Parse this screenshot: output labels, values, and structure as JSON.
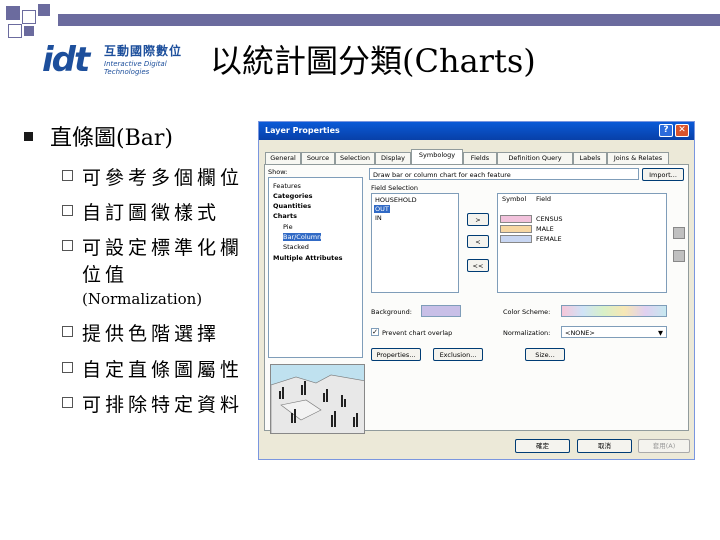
{
  "slide": {
    "title": "以統計圖分類(Charts)",
    "logo_mark": "idt",
    "logo_cn": "互動國際數位",
    "logo_en": "Interactive Digital Technologies",
    "heading": "直條圖(Bar)",
    "bullets": [
      "可參考多個欄位",
      "自訂圖徵樣式",
      "可設定標準化欄",
      "位值"
    ],
    "normalization_note": "(Normalization)",
    "bullets2": [
      "提供色階選擇",
      "自定直條圖屬性",
      "可排除特定資料"
    ]
  },
  "dialog": {
    "title": "Layer Properties",
    "tabs": [
      "General",
      "Source",
      "Selection",
      "Display",
      "Symbology",
      "Fields",
      "Definition Query",
      "Labels",
      "Joins & Relates"
    ],
    "active_tab": "Symbology",
    "show_label": "Show:",
    "show_items": [
      "Features",
      "Categories",
      "Quantities",
      "Charts",
      "Pie",
      "Bar/Column",
      "Stacked",
      "Multiple Attributes"
    ],
    "description": "Draw bar or column chart for each feature",
    "import_button": "Import...",
    "field_selection_label": "Field Selection",
    "fields": [
      "HOUSEHOLD",
      "OUT",
      "IN"
    ],
    "symbol_header": "Symbol",
    "field_header": "Field",
    "symbol_rows": [
      {
        "label": "CENSUS",
        "color": "#f2c2dc"
      },
      {
        "label": "MALE",
        "color": "#f7d7a3"
      },
      {
        "label": "FEMALE",
        "color": "#c8d6f2"
      }
    ],
    "move_buttons": [
      ">",
      "<",
      "<<"
    ],
    "background_label": "Background:",
    "color_scheme_label": "Color Scheme:",
    "prevent_overlap_label": "Prevent chart overlap",
    "normalization_label": "Normalization:",
    "normalization_value": "<NONE>",
    "properties_button": "Properties...",
    "exclusion_button": "Exclusion...",
    "size_button": "Size...",
    "ok_button": "確定",
    "cancel_button": "取消",
    "apply_button": "套用(A)",
    "help_icon": "?",
    "close_icon": "✕",
    "colors": {
      "titlebar": "#0a5ad7",
      "selected": "#316ac5",
      "background_swatch": "#c8bfe7"
    }
  }
}
